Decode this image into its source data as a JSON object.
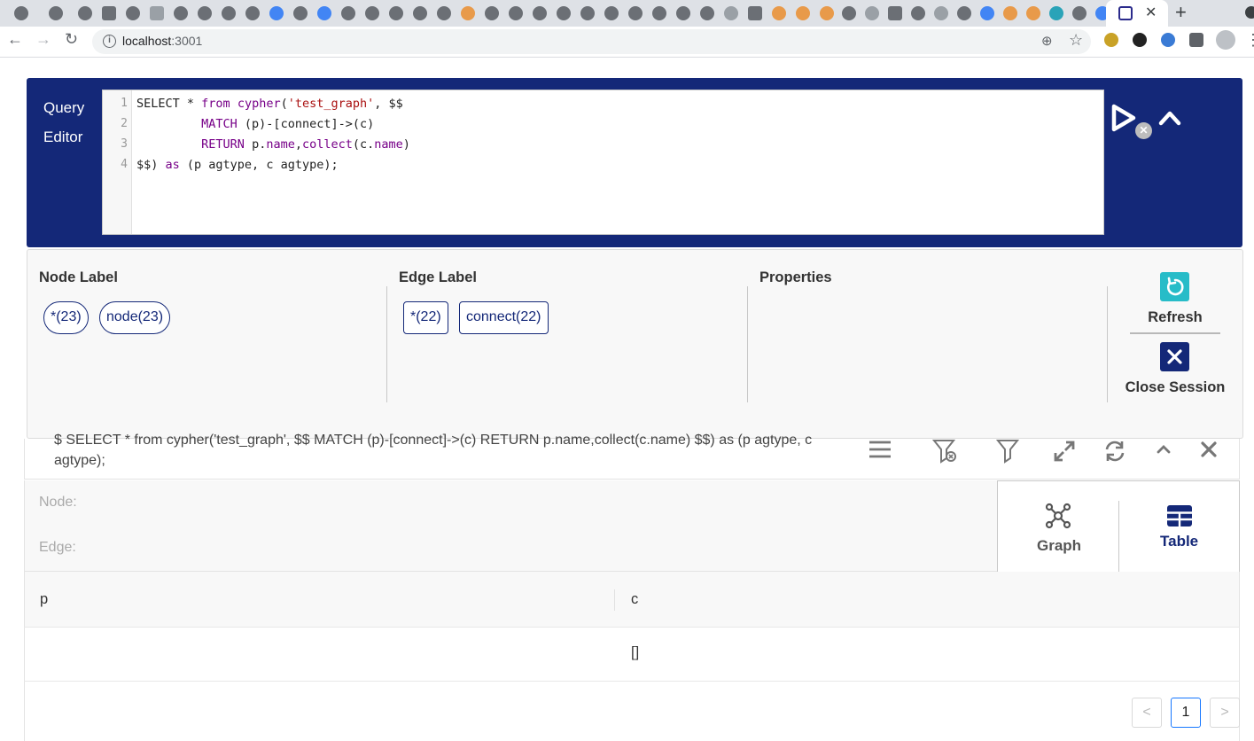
{
  "browser": {
    "url_host": "localhost",
    "url_port": ":3001",
    "tab_close": "✕",
    "new_tab": "+"
  },
  "editor": {
    "title_line1": "Query",
    "title_line2": "Editor",
    "line_numbers": [
      "1",
      "2",
      "3",
      "4"
    ],
    "code": {
      "l1_a": "SELECT * ",
      "l1_b": "from",
      "l1_c": " ",
      "l1_d": "cypher",
      "l1_e": "(",
      "l1_f": "'test_graph'",
      "l1_g": ", $$",
      "l2_indent": "         ",
      "l2_a": "MATCH",
      "l2_b": " (p)-[connect]->(c)",
      "l3_indent": "         ",
      "l3_a": "RETURN",
      "l3_b": " p.",
      "l3_c": "name",
      "l3_d": ",",
      "l3_e": "collect",
      "l3_f": "(c.",
      "l3_g": "name",
      "l3_h": ")",
      "l4_a": "$$) ",
      "l4_b": "as",
      "l4_c": " (p agtype, c agtype);"
    },
    "clear_glyph": "✕"
  },
  "meta": {
    "node_label_heading": "Node Label",
    "edge_label_heading": "Edge Label",
    "properties_heading": "Properties",
    "node_labels": [
      "*(23)",
      "node(23)"
    ],
    "edge_labels": [
      "*(22)",
      "connect(22)"
    ],
    "refresh_label": "Refresh",
    "close_session_label": "Close Session",
    "refresh_color": "#27bcc8",
    "close_color": "#142878"
  },
  "result": {
    "query_text": "$ SELECT * from cypher('test_graph', $$ MATCH (p)-[connect]->(c) RETURN p.name,collect(c.name) $$) as (p agtype, c agtype);",
    "node_filter_label": "Node:",
    "edge_filter_label": "Edge:",
    "graph_label": "Graph",
    "table_label": "Table",
    "columns": [
      "p",
      "c"
    ],
    "rows": [
      [
        "",
        "[]"
      ]
    ],
    "pagination": {
      "prev": "<",
      "current": "1",
      "next": ">"
    }
  },
  "colors": {
    "primary": "#142878",
    "accent": "#27bcc8"
  }
}
